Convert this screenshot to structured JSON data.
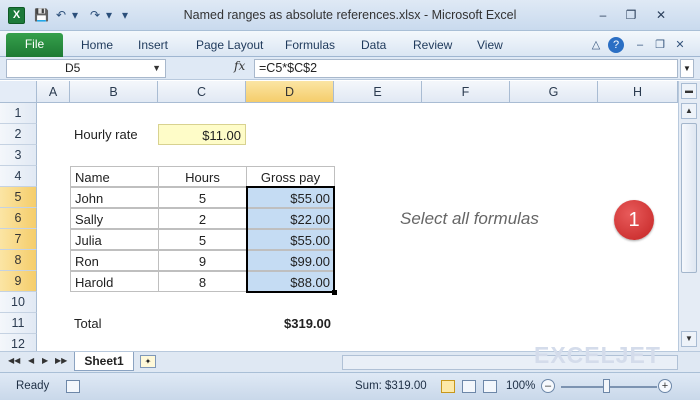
{
  "window": {
    "title": "Named ranges as absolute references.xlsx  -  Microsoft Excel",
    "app_logo": "X"
  },
  "ribbon": {
    "tabs": [
      "File",
      "Home",
      "Insert",
      "Page Layout",
      "Formulas",
      "Data",
      "Review",
      "View"
    ]
  },
  "formula_bar": {
    "name_box": "D5",
    "fx_label": "fx",
    "formula": "=C5*$C$2"
  },
  "columns": [
    "A",
    "B",
    "C",
    "D",
    "E",
    "F",
    "G",
    "H"
  ],
  "selected_column": "D",
  "rows": [
    "1",
    "2",
    "3",
    "4",
    "5",
    "6",
    "7",
    "8",
    "9",
    "10",
    "11",
    "12"
  ],
  "sheet": {
    "rate_label": "Hourly rate",
    "rate_value": "$11.00",
    "headers": [
      "Name",
      "Hours",
      "Gross pay"
    ],
    "employees": [
      {
        "name": "John",
        "hours": "5",
        "gross": "$55.00"
      },
      {
        "name": "Sally",
        "hours": "2",
        "gross": "$22.00"
      },
      {
        "name": "Julia",
        "hours": "5",
        "gross": "$55.00"
      },
      {
        "name": "Ron",
        "hours": "9",
        "gross": "$99.00"
      },
      {
        "name": "Harold",
        "hours": "8",
        "gross": "$88.00"
      }
    ],
    "total_label": "Total",
    "total_value": "$319.00"
  },
  "annotation": {
    "hint": "Select all formulas",
    "step_badge": "1"
  },
  "sheet_tabs": {
    "active": "Sheet1"
  },
  "watermark": "EXCELJET",
  "status_bar": {
    "mode": "Ready",
    "sum": "Sum: $319.00",
    "zoom": "100%"
  },
  "colors": {
    "selection_fill": "#c5dcf3",
    "rate_fill": "#fefcc8",
    "badge": "#d63535",
    "file_tab": "#2a8c3f"
  }
}
